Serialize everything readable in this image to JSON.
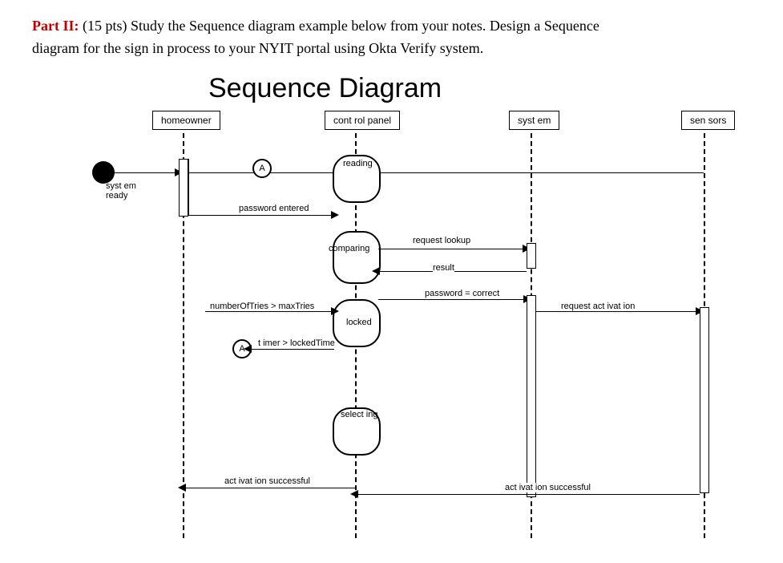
{
  "question": {
    "part_label": "Part II:",
    "pts": "(15 pts)",
    "text1": "Study the Sequence diagram example below from your notes. Design a Sequence",
    "text2": "diagram for the sign in process to your NYIT portal using Okta Verify system."
  },
  "diagram": {
    "title": "Sequence Diagram",
    "participants": {
      "p1": "homeowner",
      "p2": "cont rol panel",
      "p3": "syst em",
      "p4": "sen sors"
    },
    "start_label": "syst em\nready",
    "connector_a": "A",
    "states": {
      "reading": "reading",
      "comparing": "comparing",
      "locked": "locked",
      "selecting": "select ing"
    },
    "messages": {
      "password_entered": "password entered",
      "request_lookup": "request  lookup",
      "result": "result",
      "password_correct": "password = correct",
      "num_tries": "numberOfTries > maxTries",
      "timer_locked": "t imer > lockedTime",
      "request_activation": "request act ivat ion",
      "activation_successful1": "act ivat ion successful",
      "activation_successful2": "act ivat ion successful"
    }
  }
}
